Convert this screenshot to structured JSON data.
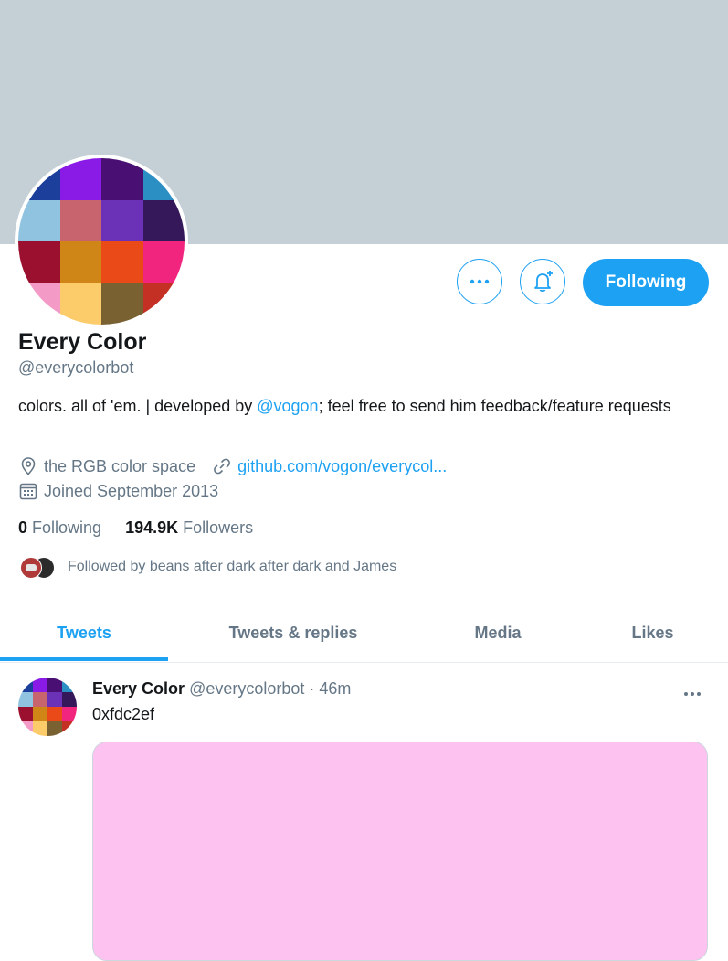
{
  "profile": {
    "name": "Every Color",
    "handle": "@everycolorbot",
    "bio_text": "colors.  all of 'em. | developed by ",
    "bio_mention": "@vogon",
    "bio_rest": "; feel free to send him feedback/feature requests",
    "location": "the RGB color space",
    "website": "github.com/vogon/everycol...",
    "joined": "Joined September 2013",
    "following_count": "0",
    "following_label": "Following",
    "followers_count": "194.9K",
    "followers_label": "Followers",
    "followed_by": "Followed by beans after dark after dark and James"
  },
  "actions": {
    "follow_label": "Following"
  },
  "tabs": [
    {
      "label": "Tweets",
      "active": true
    },
    {
      "label": "Tweets & replies",
      "active": false
    },
    {
      "label": "Media",
      "active": false
    },
    {
      "label": "Likes",
      "active": false
    }
  ],
  "tweet": {
    "name": "Every Color",
    "handle": "@everycolorbot",
    "separator": " · ",
    "time": "46m",
    "text": "0xfdc2ef",
    "media_color": "#fdc2ef"
  },
  "avatar_colors": [
    "#1b3f9a",
    "#8a1be6",
    "#4a0f72",
    "#2b8fc4",
    "#8fc3e0",
    "#c8646e",
    "#6b32b8",
    "#341859",
    "#9b0f2f",
    "#cf8617",
    "#e94a17",
    "#f2257e",
    "#f49ac7",
    "#fccb6a",
    "#7a6132",
    "#c43024"
  ],
  "colors": {
    "accent": "#1da1f2",
    "banner": "#c4cfd6",
    "secondary_text": "#657786"
  },
  "icons": {
    "more": "more-dots-icon",
    "bell": "notification-bell-plus-icon",
    "location": "location-pin-icon",
    "link": "link-icon",
    "calendar": "calendar-icon"
  }
}
